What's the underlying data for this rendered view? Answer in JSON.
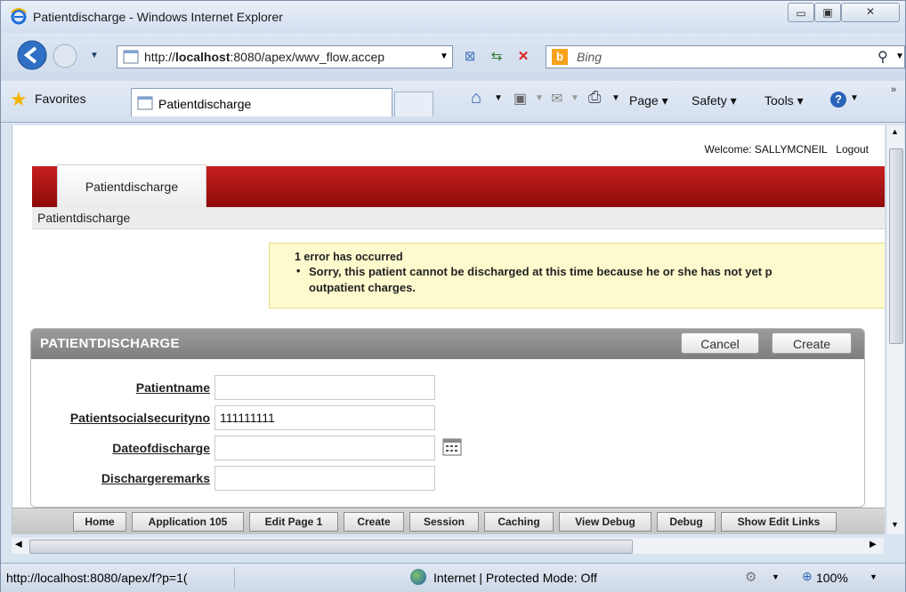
{
  "window": {
    "title": "Patientdischarge - Windows Internet Explorer"
  },
  "toolbar": {
    "address": "http://localhost:8080/apex/wwv_flow.accep",
    "address_host_bold": "localhost",
    "search_placeholder": "Bing",
    "favorites_label": "Favorites",
    "tab_title": "Patientdischarge",
    "commands": {
      "page": "Page ▾",
      "safety": "Safety ▾",
      "tools": "Tools ▾"
    }
  },
  "page": {
    "welcome_text": "Welcome: SALLYMCNEIL",
    "logout_link": "Logout",
    "tab_label": "Patientdischarge",
    "breadcrumb": "Patientdischarge",
    "error": {
      "header": "1 error has occurred",
      "message": "Sorry, this patient cannot be discharged at this time because he or she has not yet p",
      "message_line2": "outpatient charges."
    },
    "region": {
      "title": "PATIENTDISCHARGE",
      "cancel_label": "Cancel",
      "create_label": "Create"
    },
    "fields": {
      "patientname_label": "Patientname",
      "patientname_value": "",
      "ssn_label": "Patientsocialsecurityno",
      "ssn_value": "111111111",
      "dateofdischarge_label": "Dateofdischarge",
      "dateofdischarge_value": "",
      "dischargeremarks_label": "Dischargeremarks",
      "dischargeremarks_value": ""
    },
    "dev_toolbar": [
      "Home",
      "Application 105",
      "Edit Page 1",
      "Create",
      "Session",
      "Caching",
      "View Debug",
      "Debug",
      "Show Edit Links"
    ]
  },
  "statusbar": {
    "url": "http://localhost:8080/apex/f?p=1(",
    "zone": "Internet | Protected Mode: Off",
    "zoom": "100%"
  }
}
